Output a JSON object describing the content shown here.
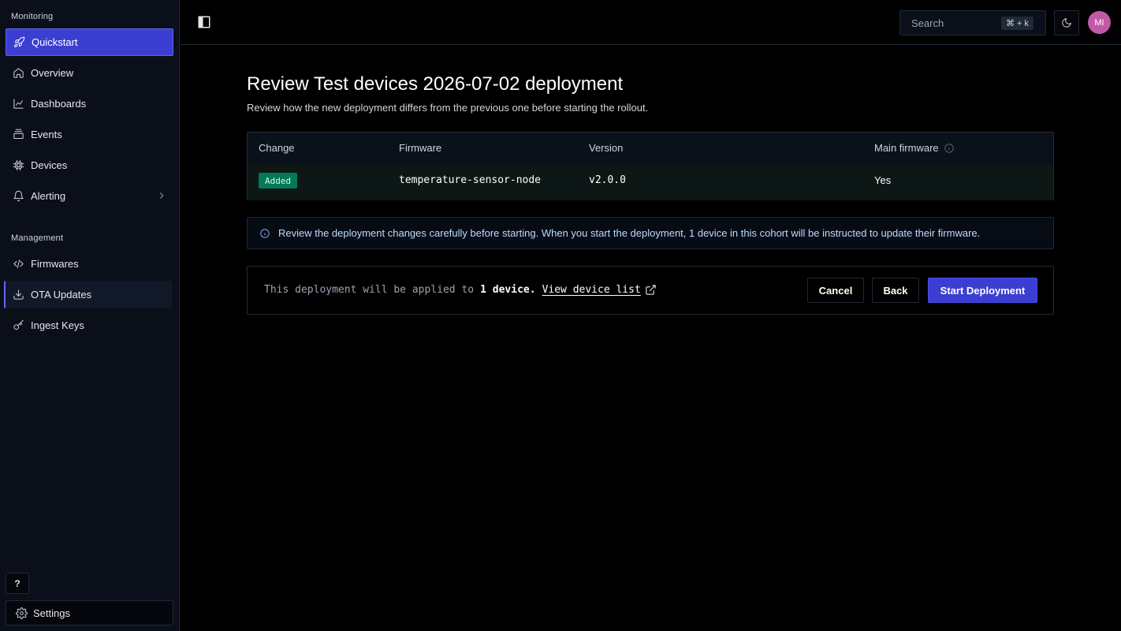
{
  "sidebar": {
    "monitoring_label": "Monitoring",
    "management_label": "Management",
    "items": [
      {
        "label": "Quickstart",
        "icon": "rocket-icon"
      },
      {
        "label": "Overview",
        "icon": "home-icon"
      },
      {
        "label": "Dashboards",
        "icon": "chart-line-icon"
      },
      {
        "label": "Events",
        "icon": "stack-icon"
      },
      {
        "label": "Devices",
        "icon": "chip-icon"
      },
      {
        "label": "Alerting",
        "icon": "bell-icon"
      },
      {
        "label": "Firmwares",
        "icon": "code-icon"
      },
      {
        "label": "OTA Updates",
        "icon": "download-icon"
      },
      {
        "label": "Ingest Keys",
        "icon": "key-icon"
      }
    ],
    "help_label": "?",
    "settings_label": "Settings"
  },
  "topbar": {
    "search_placeholder": "Search",
    "shortcut": "⌘ + k",
    "avatar_initials": "MI"
  },
  "main": {
    "title": "Review Test devices 2026-07-02 deployment",
    "subtitle": "Review how the new deployment differs from the previous one before starting the rollout.",
    "table": {
      "headers": [
        "Change",
        "Firmware",
        "Version",
        "Main firmware"
      ],
      "rows": [
        {
          "change": "Added",
          "firmware": "temperature-sensor-node",
          "version": "v2.0.0",
          "main": "Yes"
        }
      ]
    },
    "alert_text": "Review the deployment changes carefully before starting. When you start the deployment, 1 device in this cohort will be instructed to update their firmware.",
    "apply": {
      "prefix": "This deployment will be applied to",
      "count": "1 device.",
      "link": "View device list"
    },
    "buttons": {
      "cancel": "Cancel",
      "back": "Back",
      "start": "Start Deployment"
    }
  },
  "colors": {
    "accent": "#3b3fd1",
    "badge_green": "#047857",
    "avatar": "#c05aa8"
  }
}
